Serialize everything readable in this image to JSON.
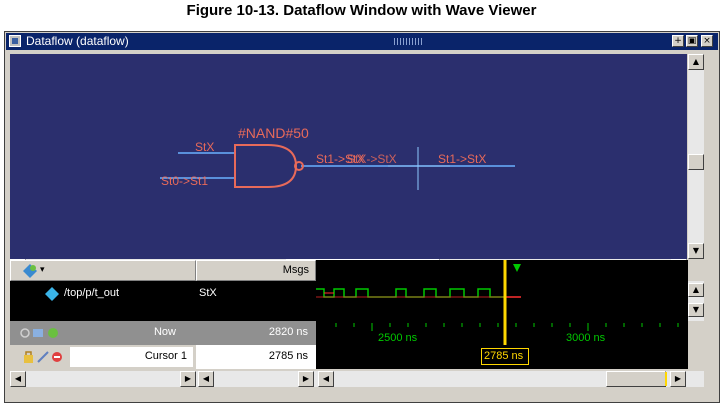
{
  "caption": "Figure 10-13. Dataflow Window with Wave Viewer",
  "window": {
    "title": "Dataflow (dataflow)",
    "buttons": {
      "dock": "+",
      "restore": "▣",
      "close": "×"
    }
  },
  "dataflow": {
    "gate_label": "#NAND#50",
    "input_a": "StX",
    "input_b": "St0->St1",
    "output_label": "St1->StX",
    "overlap_label": "StX->StX",
    "far_label": "St1->StX"
  },
  "wave": {
    "header_msgs": "Msgs",
    "signal_path": "/top/p/t_out",
    "signal_value": "StX",
    "now_label": "Now",
    "now_value": "2820 ns",
    "cursor_label": "Cursor 1",
    "cursor_value": "2785 ns",
    "timeline_ticks": [
      "2500 ns",
      "3000 ns"
    ],
    "cursor_marker": "2785 ns"
  },
  "colors": {
    "canvas": "#2b2f6e",
    "gate": "#e86a5a",
    "wave_green": "#00c800",
    "wave_red": "#ff3030",
    "cursor": "#ffd700"
  },
  "icons": {
    "signal_icon": "cyan-diamond-icon",
    "now_icons": "zoom-icons",
    "cursor_icons": "lock-pencil-delete-icons"
  }
}
